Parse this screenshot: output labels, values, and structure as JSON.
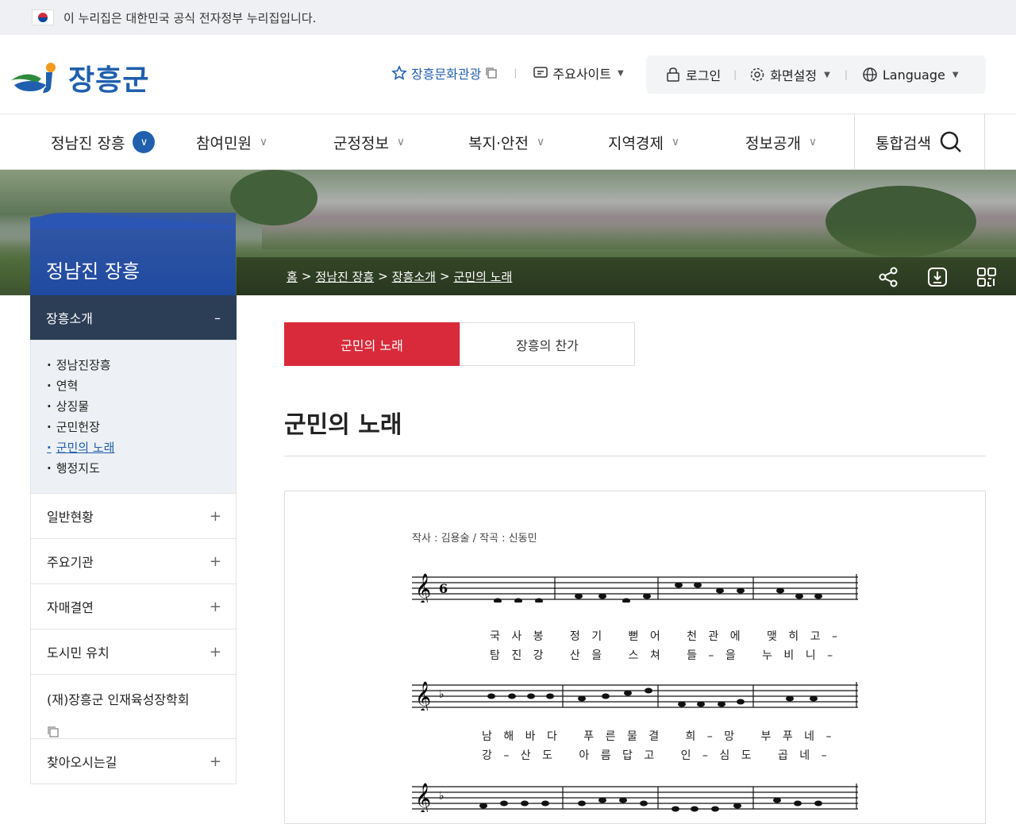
{
  "gov_notice": "이 누리집은 대한민국 공식 전자정부 누리집입니다.",
  "logo": {
    "name": "장흥군"
  },
  "util": {
    "culture": "장흥문화관광",
    "sites": "주요사이트",
    "login": "로그인",
    "display": "화면설정",
    "language": "Language"
  },
  "gnb": [
    "정남진 장흥",
    "참여민원",
    "군정정보",
    "복지·안전",
    "지역경제",
    "정보공개"
  ],
  "search_label": "통합검색",
  "breadcrumb": [
    "홈",
    "정남진 장흥",
    "장흥소개",
    "군민의 노래"
  ],
  "side": {
    "title": "정남진 장흥",
    "head": "장흥소개",
    "sub": [
      "정남진장흥",
      "연혁",
      "상징물",
      "군민헌장",
      "군민의 노래",
      "행정지도"
    ],
    "menus": [
      "일반현황",
      "주요기관",
      "자매결연",
      "도시민 유치",
      "(재)장흥군 인재육성장학회",
      "찾아오시는길"
    ]
  },
  "tabs": [
    "군민의 노래",
    "장흥의 찬가"
  ],
  "page_title": "군민의 노래",
  "score": {
    "credits": "작사 : 김용술 / 작곡 : 신동민",
    "lyrics": [
      [
        "국 사 봉",
        "정 기",
        "뻗 어",
        "천 관 에",
        "맺 히 고 –"
      ],
      [
        "탐 진 강",
        "산 을",
        "스 쳐",
        "들 – 을",
        "누 비 니 –"
      ],
      [
        "남 해 바 다",
        "푸 른 물 결",
        "희 – 망",
        "부 푸 네 –"
      ],
      [
        "강 – 산 도",
        "아 름 답 고",
        "인 – 심 도",
        "곱 네 –"
      ]
    ]
  },
  "colors": {
    "brand_blue": "#1f5fae",
    "tab_active": "#d82a3a",
    "side_head": "#2c3e55"
  }
}
